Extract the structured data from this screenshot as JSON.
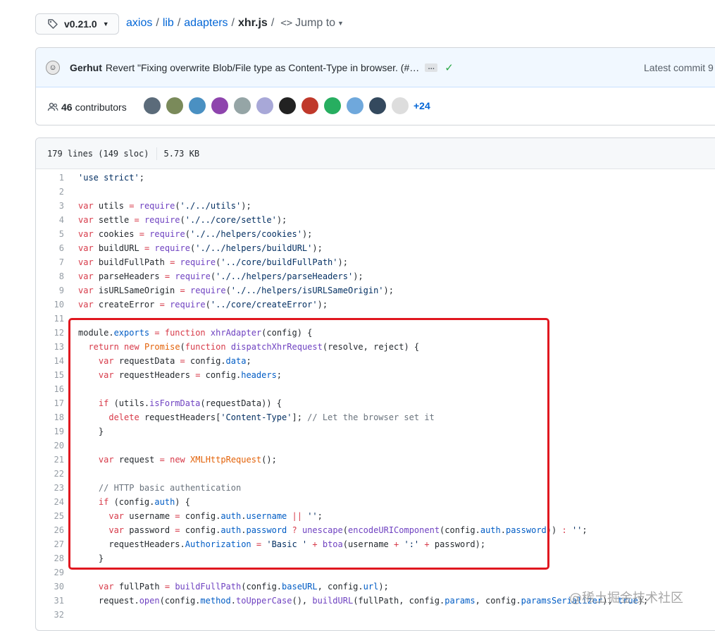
{
  "header": {
    "branch": "v0.21.0",
    "breadcrumb": [
      "axios",
      "lib",
      "adapters"
    ],
    "file_name": "xhr.js",
    "jump_to": "Jump to"
  },
  "commit": {
    "author": "Gerhut",
    "message": "Revert \"Fixing overwrite Blob/File type as Content-Type in browser. (#…",
    "ellipsis": "…",
    "status": "success",
    "latest": "Latest commit 9"
  },
  "contributors": {
    "count": "46",
    "label": "contributors",
    "more": "+24",
    "avatar_colors": [
      "#5b6b7a",
      "#7a8a5a",
      "#4a90c2",
      "#8e44ad",
      "#95a5a6",
      "#a8a8d8",
      "#222222",
      "#c0392b",
      "#27ae60",
      "#6fa8dc",
      "#34495e",
      "#dddddd"
    ]
  },
  "file": {
    "lines_info": "179 lines (149 sloc)",
    "size": "5.73 KB"
  },
  "code": [
    {
      "n": "1",
      "t": [
        [
          "s",
          "'use strict'"
        ],
        [
          "",
          "; "
        ]
      ]
    },
    {
      "n": "2",
      "t": []
    },
    {
      "n": "3",
      "t": [
        [
          "k",
          "var"
        ],
        [
          "",
          " utils "
        ],
        [
          "k",
          "="
        ],
        [
          "",
          " "
        ],
        [
          "f",
          "require"
        ],
        [
          "",
          "("
        ],
        [
          "s",
          "'./../utils'"
        ],
        [
          "",
          ");"
        ]
      ]
    },
    {
      "n": "4",
      "t": [
        [
          "k",
          "var"
        ],
        [
          "",
          " settle "
        ],
        [
          "k",
          "="
        ],
        [
          "",
          " "
        ],
        [
          "f",
          "require"
        ],
        [
          "",
          "("
        ],
        [
          "s",
          "'./../core/settle'"
        ],
        [
          "",
          ");"
        ]
      ]
    },
    {
      "n": "5",
      "t": [
        [
          "k",
          "var"
        ],
        [
          "",
          " cookies "
        ],
        [
          "k",
          "="
        ],
        [
          "",
          " "
        ],
        [
          "f",
          "require"
        ],
        [
          "",
          "("
        ],
        [
          "s",
          "'./../helpers/cookies'"
        ],
        [
          "",
          ");"
        ]
      ]
    },
    {
      "n": "6",
      "t": [
        [
          "k",
          "var"
        ],
        [
          "",
          " buildURL "
        ],
        [
          "k",
          "="
        ],
        [
          "",
          " "
        ],
        [
          "f",
          "require"
        ],
        [
          "",
          "("
        ],
        [
          "s",
          "'./../helpers/buildURL'"
        ],
        [
          "",
          ");"
        ]
      ]
    },
    {
      "n": "7",
      "t": [
        [
          "k",
          "var"
        ],
        [
          "",
          " buildFullPath "
        ],
        [
          "k",
          "="
        ],
        [
          "",
          " "
        ],
        [
          "f",
          "require"
        ],
        [
          "",
          "("
        ],
        [
          "s",
          "'../core/buildFullPath'"
        ],
        [
          "",
          ");"
        ]
      ]
    },
    {
      "n": "8",
      "t": [
        [
          "k",
          "var"
        ],
        [
          "",
          " parseHeaders "
        ],
        [
          "k",
          "="
        ],
        [
          "",
          " "
        ],
        [
          "f",
          "require"
        ],
        [
          "",
          "("
        ],
        [
          "s",
          "'./../helpers/parseHeaders'"
        ],
        [
          "",
          ");"
        ]
      ]
    },
    {
      "n": "9",
      "t": [
        [
          "k",
          "var"
        ],
        [
          "",
          " isURLSameOrigin "
        ],
        [
          "k",
          "="
        ],
        [
          "",
          " "
        ],
        [
          "f",
          "require"
        ],
        [
          "",
          "("
        ],
        [
          "s",
          "'./../helpers/isURLSameOrigin'"
        ],
        [
          "",
          ");"
        ]
      ]
    },
    {
      "n": "10",
      "t": [
        [
          "k",
          "var"
        ],
        [
          "",
          " createError "
        ],
        [
          "k",
          "="
        ],
        [
          "",
          " "
        ],
        [
          "f",
          "require"
        ],
        [
          "",
          "("
        ],
        [
          "s",
          "'../core/createError'"
        ],
        [
          "",
          ");"
        ]
      ]
    },
    {
      "n": "11",
      "t": []
    },
    {
      "n": "12",
      "t": [
        [
          "",
          "module."
        ],
        [
          "p",
          "exports"
        ],
        [
          "",
          " "
        ],
        [
          "k",
          "="
        ],
        [
          "",
          " "
        ],
        [
          "k",
          "function"
        ],
        [
          "",
          " "
        ],
        [
          "f",
          "xhrAdapter"
        ],
        [
          "",
          "(config) {"
        ]
      ]
    },
    {
      "n": "13",
      "t": [
        [
          "",
          "  "
        ],
        [
          "k",
          "return"
        ],
        [
          "",
          " "
        ],
        [
          "k",
          "new"
        ],
        [
          "",
          " "
        ],
        [
          "o",
          "Promise"
        ],
        [
          "",
          "("
        ],
        [
          "k",
          "function"
        ],
        [
          "",
          " "
        ],
        [
          "f",
          "dispatchXhrRequest"
        ],
        [
          "",
          "(resolve, reject) {"
        ]
      ]
    },
    {
      "n": "14",
      "t": [
        [
          "",
          "    "
        ],
        [
          "k",
          "var"
        ],
        [
          "",
          " requestData "
        ],
        [
          "k",
          "="
        ],
        [
          "",
          " config."
        ],
        [
          "p",
          "data"
        ],
        [
          "",
          ";"
        ]
      ]
    },
    {
      "n": "15",
      "t": [
        [
          "",
          "    "
        ],
        [
          "k",
          "var"
        ],
        [
          "",
          " requestHeaders "
        ],
        [
          "k",
          "="
        ],
        [
          "",
          " config."
        ],
        [
          "p",
          "headers"
        ],
        [
          "",
          ";"
        ]
      ]
    },
    {
      "n": "16",
      "t": []
    },
    {
      "n": "17",
      "t": [
        [
          "",
          "    "
        ],
        [
          "k",
          "if"
        ],
        [
          "",
          " (utils."
        ],
        [
          "f",
          "isFormData"
        ],
        [
          "",
          "(requestData)) {"
        ]
      ]
    },
    {
      "n": "18",
      "t": [
        [
          "",
          "      "
        ],
        [
          "k",
          "delete"
        ],
        [
          "",
          " requestHeaders["
        ],
        [
          "s",
          "'Content-Type'"
        ],
        [
          "",
          "]; "
        ],
        [
          "c",
          "// Let the browser set it"
        ]
      ]
    },
    {
      "n": "19",
      "t": [
        [
          "",
          "    }"
        ]
      ]
    },
    {
      "n": "20",
      "t": []
    },
    {
      "n": "21",
      "t": [
        [
          "",
          "    "
        ],
        [
          "k",
          "var"
        ],
        [
          "",
          " request "
        ],
        [
          "k",
          "="
        ],
        [
          "",
          " "
        ],
        [
          "k",
          "new"
        ],
        [
          "",
          " "
        ],
        [
          "o",
          "XMLHttpRequest"
        ],
        [
          "",
          "();"
        ]
      ]
    },
    {
      "n": "22",
      "t": []
    },
    {
      "n": "23",
      "t": [
        [
          "",
          "    "
        ],
        [
          "c",
          "// HTTP basic authentication"
        ]
      ]
    },
    {
      "n": "24",
      "t": [
        [
          "",
          "    "
        ],
        [
          "k",
          "if"
        ],
        [
          "",
          " (config."
        ],
        [
          "p",
          "auth"
        ],
        [
          "",
          ") {"
        ]
      ]
    },
    {
      "n": "25",
      "t": [
        [
          "",
          "      "
        ],
        [
          "k",
          "var"
        ],
        [
          "",
          " username "
        ],
        [
          "k",
          "="
        ],
        [
          "",
          " config."
        ],
        [
          "p",
          "auth"
        ],
        [
          "",
          "."
        ],
        [
          "p",
          "username"
        ],
        [
          "",
          " "
        ],
        [
          "k",
          "||"
        ],
        [
          "",
          " "
        ],
        [
          "s",
          "''"
        ],
        [
          "",
          ";"
        ]
      ]
    },
    {
      "n": "26",
      "t": [
        [
          "",
          "      "
        ],
        [
          "k",
          "var"
        ],
        [
          "",
          " password "
        ],
        [
          "k",
          "="
        ],
        [
          "",
          " config."
        ],
        [
          "p",
          "auth"
        ],
        [
          "",
          "."
        ],
        [
          "p",
          "password"
        ],
        [
          "",
          " "
        ],
        [
          "k",
          "?"
        ],
        [
          "",
          " "
        ],
        [
          "f",
          "unescape"
        ],
        [
          "",
          "("
        ],
        [
          "f",
          "encodeURIComponent"
        ],
        [
          "",
          "(config."
        ],
        [
          "p",
          "auth"
        ],
        [
          "",
          "."
        ],
        [
          "p",
          "password"
        ],
        [
          "",
          ")) "
        ],
        [
          "k",
          ":"
        ],
        [
          "",
          " "
        ],
        [
          "s",
          "''"
        ],
        [
          "",
          ";"
        ]
      ]
    },
    {
      "n": "27",
      "t": [
        [
          "",
          "      requestHeaders."
        ],
        [
          "p",
          "Authorization"
        ],
        [
          "",
          " "
        ],
        [
          "k",
          "="
        ],
        [
          "",
          " "
        ],
        [
          "s",
          "'Basic '"
        ],
        [
          "",
          " "
        ],
        [
          "k",
          "+"
        ],
        [
          "",
          " "
        ],
        [
          "f",
          "btoa"
        ],
        [
          "",
          "(username "
        ],
        [
          "k",
          "+"
        ],
        [
          "",
          " "
        ],
        [
          "s",
          "':'"
        ],
        [
          "",
          " "
        ],
        [
          "k",
          "+"
        ],
        [
          "",
          " password);"
        ]
      ]
    },
    {
      "n": "28",
      "t": [
        [
          "",
          "    }"
        ]
      ]
    },
    {
      "n": "29",
      "t": []
    },
    {
      "n": "30",
      "t": [
        [
          "",
          "    "
        ],
        [
          "k",
          "var"
        ],
        [
          "",
          " fullPath "
        ],
        [
          "k",
          "="
        ],
        [
          "",
          " "
        ],
        [
          "f",
          "buildFullPath"
        ],
        [
          "",
          "(config."
        ],
        [
          "p",
          "baseURL"
        ],
        [
          "",
          ", config."
        ],
        [
          "p",
          "url"
        ],
        [
          "",
          ");"
        ]
      ]
    },
    {
      "n": "31",
      "t": [
        [
          "",
          "    request."
        ],
        [
          "f",
          "open"
        ],
        [
          "",
          "(config."
        ],
        [
          "p",
          "method"
        ],
        [
          "",
          "."
        ],
        [
          "f",
          "toUpperCase"
        ],
        [
          "",
          "(), "
        ],
        [
          "f",
          "buildURL"
        ],
        [
          "",
          "(fullPath, config."
        ],
        [
          "p",
          "params"
        ],
        [
          "",
          ", config."
        ],
        [
          "p",
          "paramsSerializer"
        ],
        [
          "",
          "), "
        ],
        [
          "p",
          "true"
        ],
        [
          "",
          ");"
        ]
      ]
    },
    {
      "n": "32",
      "t": []
    }
  ],
  "watermark": "@稀土掘金技术社区"
}
